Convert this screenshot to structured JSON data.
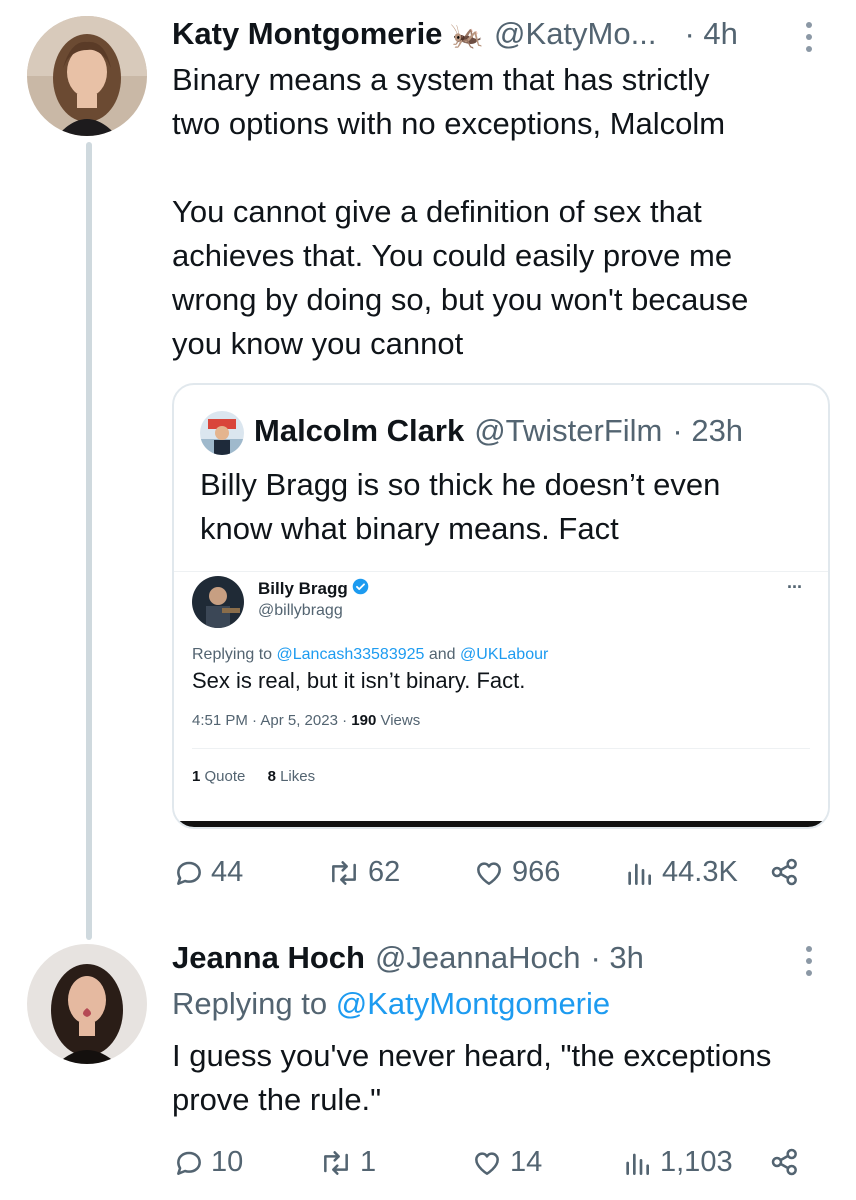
{
  "tweet": {
    "author_name": "Katy Montgomerie",
    "author_emoji": "🦗",
    "author_handle": "@KatyMo...",
    "time": "· 4h",
    "paragraph1_line1": "Binary means a system that has strictly",
    "paragraph1_line2": "two options with no exceptions, Malcolm",
    "paragraph2_line1": "You cannot give a definition of sex that",
    "paragraph2_line2": "achieves that. You could easily prove me",
    "paragraph2_line3": "wrong by doing so, but you won't because",
    "paragraph2_line4": "you know you cannot",
    "actions": {
      "replies": "44",
      "retweets": "62",
      "likes": "966",
      "views": "44.3K"
    }
  },
  "quote": {
    "author_name": "Malcolm Clark",
    "author_handle": "@TwisterFilm",
    "time": "· 23h",
    "text_line1": "Billy Bragg is so thick he doesn’t even",
    "text_line2": "know what binary means. Fact",
    "embedded": {
      "author_name": "Billy Bragg",
      "author_handle": "@billybragg",
      "replying_prefix": "Replying to",
      "replying_to1": "@Lancash33583925",
      "replying_and": "and",
      "replying_to2": "@UKLabour",
      "text": "Sex is real, but it isn’t binary. Fact.",
      "meta_time": "4:51 PM · Apr 5, 2023 ·",
      "meta_views_count": "190",
      "meta_views_label": "Views",
      "quotes_count": "1",
      "quotes_label": "Quote",
      "likes_count": "8",
      "likes_label": "Likes",
      "more": "..."
    }
  },
  "reply": {
    "author_name": "Jeanna Hoch",
    "author_handle": "@JeannaHoch",
    "time": "· 3h",
    "replying_prefix": "Replying to",
    "replying_to": "@KatyMontgomerie",
    "text_line1": "I guess you've never heard, \"the exceptions",
    "text_line2": "prove the rule.\"",
    "actions": {
      "replies": "10",
      "retweets": "1",
      "likes": "14",
      "views": "1,103"
    }
  },
  "colors": {
    "accent": "#1d9bf0",
    "secondary_text": "#536471",
    "verified": "#1d9bf0"
  }
}
